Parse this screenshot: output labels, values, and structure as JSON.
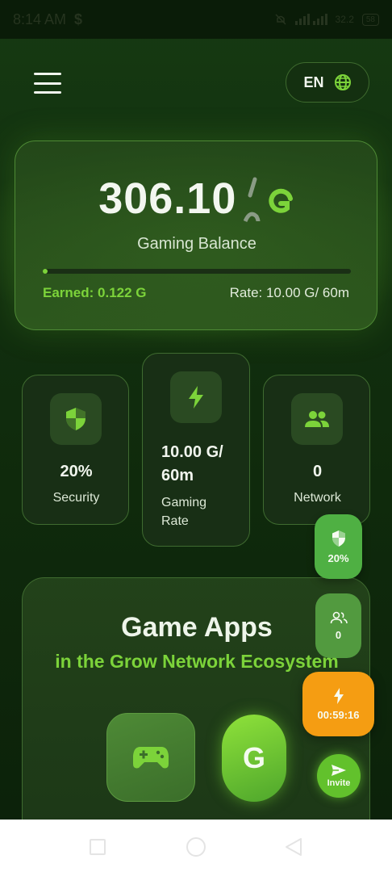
{
  "status_bar": {
    "time": "8:14 AM",
    "dollar": "$",
    "network_speed": "32.2",
    "battery": "58"
  },
  "header": {
    "language": "EN",
    "menu_icon": "hamburger-icon",
    "globe_icon": "globe-icon"
  },
  "balance": {
    "value": "306.10",
    "label": "Gaming Balance",
    "progress_fraction": 0.01,
    "earned": "Earned: 0.122 G",
    "rate": "Rate: 10.00 G/ 60m"
  },
  "stats": {
    "security": {
      "value": "20%",
      "label": "Security",
      "icon": "shield-icon"
    },
    "gaming_rate": {
      "value_line1": "10.00 G/",
      "value_line2": "60m",
      "label_line1": "Gaming",
      "label_line2": "Rate",
      "icon": "lightning-icon"
    },
    "network": {
      "value": "0",
      "label": "Network",
      "icon": "users-icon"
    }
  },
  "apps": {
    "title": "Game Apps",
    "subtitle": "in the Grow Network Ecosystem",
    "grow_tile_letter": "G"
  },
  "floating": {
    "security": "20%",
    "network": "0",
    "timer": "00:59:16",
    "invite": "Invite"
  },
  "colors": {
    "accent_green": "#7cd33a",
    "timer_orange": "#f59d12",
    "background_dark": "#12300f"
  }
}
